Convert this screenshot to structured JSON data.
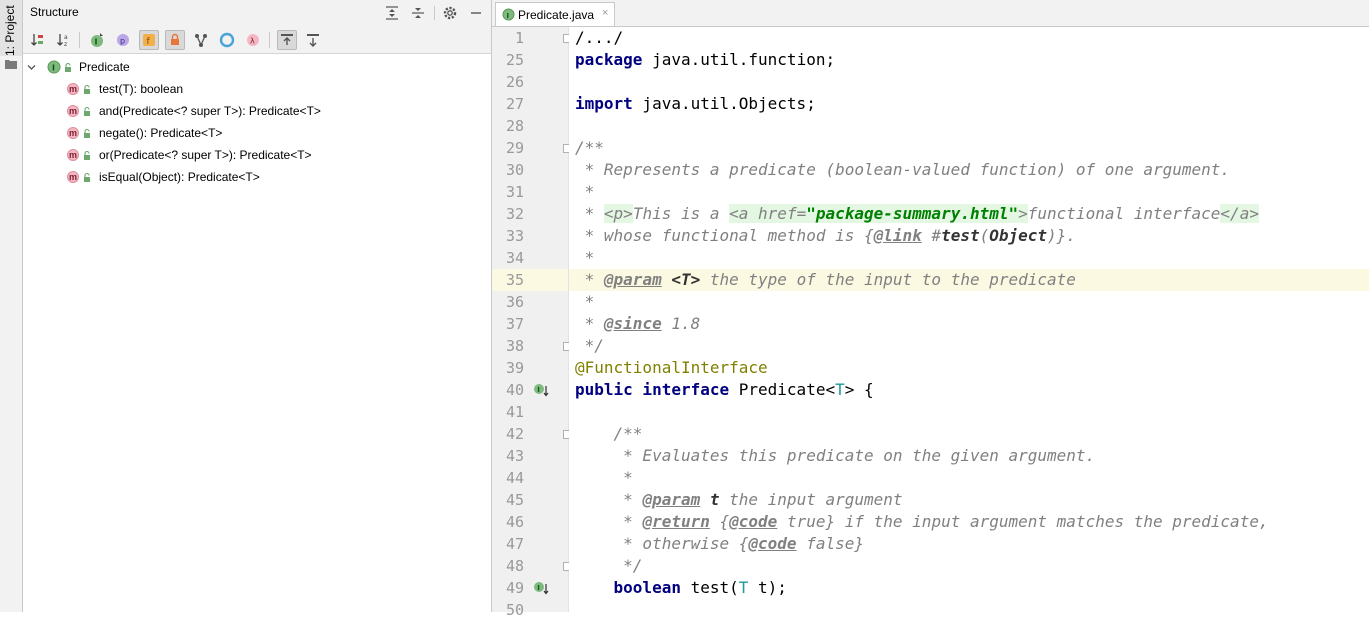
{
  "sidebar": {
    "project_tab_label": "1: Project"
  },
  "structure": {
    "title": "Structure",
    "root": {
      "label": "Predicate"
    },
    "items": [
      {
        "icon": "m",
        "label": "test(T): boolean"
      },
      {
        "icon": "m",
        "label": "and(Predicate<? super T>): Predicate<T>"
      },
      {
        "icon": "m",
        "label": "negate(): Predicate<T>"
      },
      {
        "icon": "m",
        "label": "or(Predicate<? super T>): Predicate<T>"
      },
      {
        "icon": "m-static",
        "label": "isEqual(Object): Predicate<T>"
      }
    ],
    "toolbar_icons": [
      "sort-by-visibility-icon",
      "sort-alphabetically-icon",
      "show-inherited-icon",
      "show-properties-icon",
      "show-fields-icon",
      "show-non-public-icon",
      "show-fields-tree-icon",
      "anonymous-classes-icon",
      "lambdas-icon",
      "autoscroll-to-source-icon",
      "autoscroll-from-source-icon"
    ]
  },
  "editor": {
    "tab": {
      "file_name": "Predicate.java",
      "close_glyph": "×"
    },
    "line_numbers": [
      "1",
      "25",
      "26",
      "27",
      "28",
      "29",
      "30",
      "31",
      "32",
      "33",
      "34",
      "35",
      "36",
      "37",
      "38",
      "39",
      "40",
      "41",
      "42",
      "43",
      "44",
      "45",
      "46",
      "47",
      "48",
      "49",
      "50"
    ],
    "lines": {
      "l1": "/.../",
      "l25_kw": "package",
      "l25_rest": " java.util.function;",
      "l27_kw": "import",
      "l27_rest": " java.util.Objects;",
      "l29": "/**",
      "l30": " * Represents a predicate (boolean-valued function) of one argument.",
      "l31": " *",
      "l32_a": " * ",
      "l32_p": "<p>",
      "l32_b": "This is a ",
      "l32_ahref": "<a href=",
      "l32_str": "\"package-summary.html\"",
      "l32_close": ">",
      "l32_c": "functional interface",
      "l32_aend": "</a>",
      "l33_a": " * whose functional method is {",
      "l33_link": "@link",
      "l33_b": " #",
      "l33_test": "test",
      "l33_c": "(",
      "l33_obj": "Object",
      "l33_d": ")}.",
      "l34": " *",
      "l35_a": " * ",
      "l35_param": "@param",
      "l35_t": " <T>",
      "l35_b": " the type of the input to the predicate",
      "l36": " *",
      "l37_a": " * ",
      "l37_since": "@since",
      "l37_b": " 1.8",
      "l38": " */",
      "l39": "@FunctionalInterface",
      "l40_kw": "public interface",
      "l40_a": " Predicate<",
      "l40_t": "T",
      "l40_b": "> {",
      "l42": "    /**",
      "l43": "     * Evaluates this predicate on the given argument.",
      "l44": "     *",
      "l45_a": "     * ",
      "l45_param": "@param",
      "l45_t": " t",
      "l45_b": " the input argument",
      "l46_a": "     * ",
      "l46_ret": "@return",
      "l46_b": " {",
      "l46_code": "@code",
      "l46_c": " true} if the input argument matches the predicate,",
      "l47_a": "     * otherwise {",
      "l47_code": "@code",
      "l47_b": " false}",
      "l48": "     */",
      "l49_kw": "boolean",
      "l49_a": " test(",
      "l49_t": "T",
      "l49_b": " t);"
    }
  },
  "colors": {
    "keyword": "#000080",
    "annotation": "#808000",
    "comment": "#808080",
    "type_param": "#20999d",
    "current_line": "#fcf9e3"
  }
}
